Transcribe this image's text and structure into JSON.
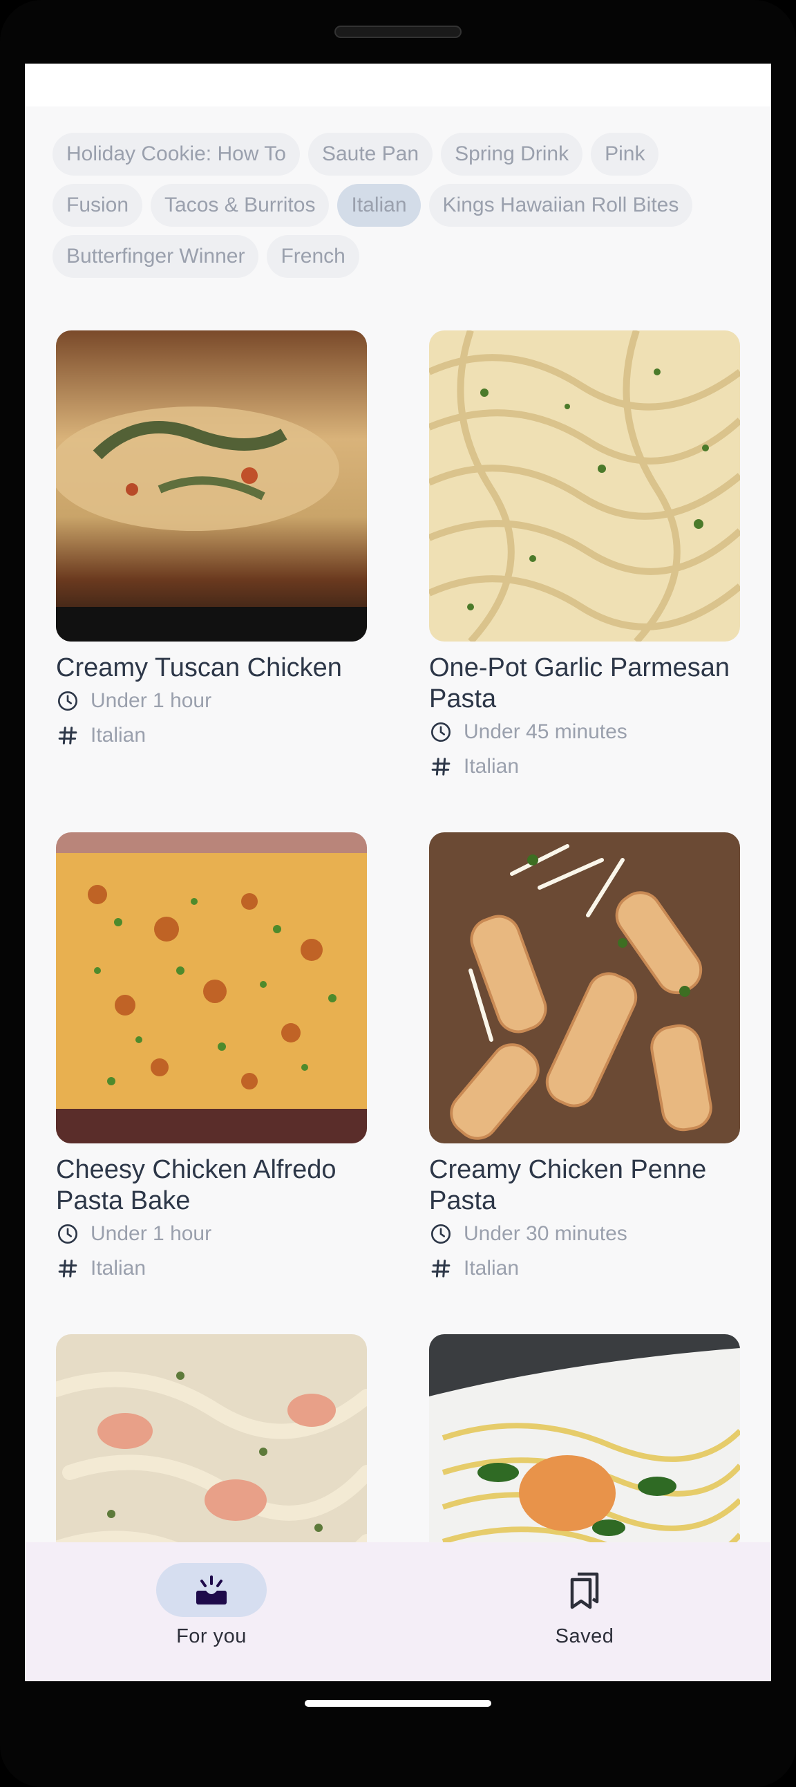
{
  "chips": [
    {
      "label": "Holiday Cookie: How To",
      "selected": false
    },
    {
      "label": "Saute Pan",
      "selected": false
    },
    {
      "label": "Spring Drink",
      "selected": false
    },
    {
      "label": "Pink",
      "selected": false
    },
    {
      "label": "Fusion",
      "selected": false
    },
    {
      "label": "Tacos & Burritos",
      "selected": false
    },
    {
      "label": "Italian",
      "selected": true
    },
    {
      "label": "Kings Hawaiian Roll Bites",
      "selected": false
    },
    {
      "label": "Butterfinger Winner",
      "selected": false
    },
    {
      "label": "French",
      "selected": false
    }
  ],
  "recipes": [
    {
      "title": "Creamy Tuscan Chicken",
      "time": "Under 1 hour",
      "tag": "Italian",
      "time_icon": "clock-icon",
      "tag_icon": "hash-icon"
    },
    {
      "title": "One-Pot Garlic Parmesan Pasta",
      "time": "Under 45 minutes",
      "tag": "Italian",
      "time_icon": "clock-icon",
      "tag_icon": "hash-icon"
    },
    {
      "title": "Cheesy Chicken Alfredo Pasta Bake",
      "time": "Under 1 hour",
      "tag": "Italian",
      "time_icon": "clock-icon",
      "tag_icon": "hash-icon"
    },
    {
      "title": "Creamy Chicken Penne Pasta",
      "time": "Under 30 minutes",
      "tag": "Italian",
      "time_icon": "clock-icon",
      "tag_icon": "hash-icon"
    }
  ],
  "nav": {
    "for_you": {
      "label": "For you",
      "icon": "sparkle-inbox-icon",
      "active": true
    },
    "saved": {
      "label": "Saved",
      "icon": "bookmarks-icon",
      "active": false
    }
  },
  "colors": {
    "accent": "#1e0a4a",
    "chip_selected": "#d3dce8",
    "nav_bg": "#f4eef7"
  }
}
